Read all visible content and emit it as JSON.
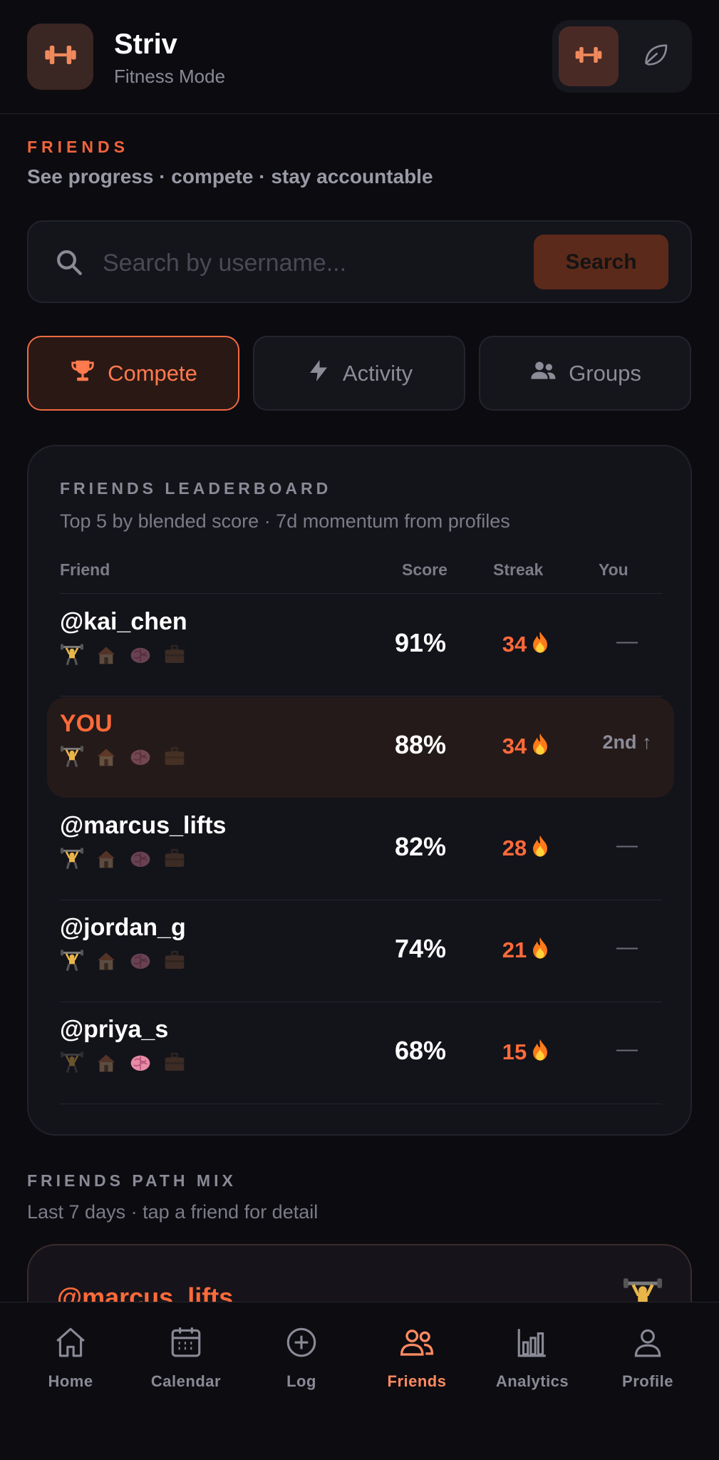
{
  "header": {
    "title": "Striv",
    "subtitle": "Fitness Mode",
    "logo_icon": "dumbbell-icon",
    "mode_options": [
      "dumbbell-icon",
      "leaf-icon"
    ],
    "accent_color": "#f0643c"
  },
  "section": {
    "kicker": "FRIENDS",
    "subtitle": "See progress · compete · stay accountable"
  },
  "search": {
    "placeholder": "Search by username...",
    "value": "",
    "button_label": "Search"
  },
  "tabs": [
    {
      "label": "Compete",
      "icon": "trophy-icon",
      "active": true
    },
    {
      "label": "Activity",
      "icon": "lightning-icon",
      "active": false
    },
    {
      "label": "Groups",
      "icon": "people-icon",
      "active": false
    }
  ],
  "leaderboard": {
    "title": "FRIENDS LEADERBOARD",
    "subtitle": "Top 5 by blended score · 7d momentum from profiles",
    "columns": {
      "friend": "Friend",
      "score": "Score",
      "streak": "Streak",
      "you": "You"
    },
    "rows": [
      {
        "name": "@kai_chen",
        "score": "91%",
        "streak": "34",
        "you": "—",
        "is_you": false
      },
      {
        "name": "YOU",
        "score": "88%",
        "streak": "34",
        "you": "2nd ↑",
        "is_you": true
      },
      {
        "name": "@marcus_lifts",
        "score": "82%",
        "streak": "28",
        "you": "—",
        "is_you": false
      },
      {
        "name": "@jordan_g",
        "score": "74%",
        "streak": "21",
        "you": "—",
        "is_you": false
      },
      {
        "name": "@priya_s",
        "score": "68%",
        "streak": "15",
        "you": "—",
        "is_you": false
      }
    ],
    "path_icons": [
      "weightlifter-icon",
      "house-icon",
      "brain-icon",
      "briefcase-icon"
    ],
    "streak_icon": "fire-icon"
  },
  "path_mix": {
    "kicker": "FRIENDS PATH MIX",
    "subtitle": "Last 7 days · tap a friend for detail",
    "card_name": "@marcus_lifts"
  },
  "nav": [
    {
      "label": "Home",
      "icon": "home-icon",
      "active": false
    },
    {
      "label": "Calendar",
      "icon": "calendar-icon",
      "active": false
    },
    {
      "label": "Log",
      "icon": "plus-circle-icon",
      "active": false
    },
    {
      "label": "Friends",
      "icon": "friends-icon",
      "active": true
    },
    {
      "label": "Analytics",
      "icon": "bar-chart-icon",
      "active": false
    },
    {
      "label": "Profile",
      "icon": "profile-icon",
      "active": false
    }
  ]
}
